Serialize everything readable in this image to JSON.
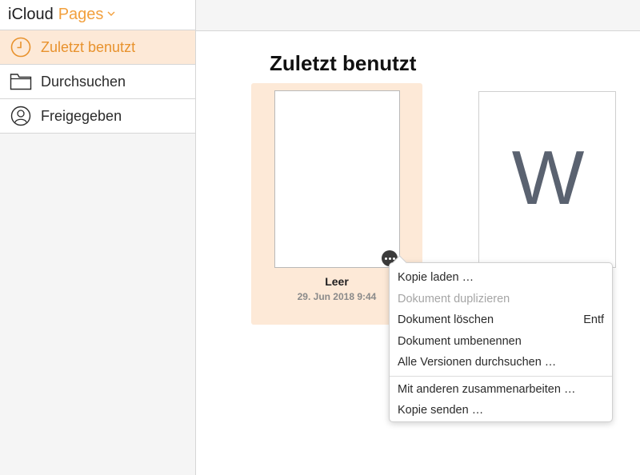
{
  "brand": {
    "app": "iCloud",
    "product": "Pages"
  },
  "sidebar": {
    "items": [
      {
        "label": "Zuletzt benutzt",
        "icon": "clock-icon",
        "active": true
      },
      {
        "label": "Durchsuchen",
        "icon": "folder-icon",
        "active": false
      },
      {
        "label": "Freigegeben",
        "icon": "shared-person-icon",
        "active": false
      }
    ]
  },
  "main": {
    "title": "Zuletzt benutzt",
    "documents": [
      {
        "name": "Leer",
        "date": "29. Jun 2018 9:44",
        "selected": true
      },
      {
        "name": "",
        "date": "",
        "thumb_letter": "W",
        "selected": false
      }
    ]
  },
  "context_menu": {
    "items": [
      {
        "label": "Kopie laden …",
        "shortcut": "",
        "enabled": true
      },
      {
        "label": "Dokument duplizieren",
        "shortcut": "",
        "enabled": false
      },
      {
        "label": "Dokument löschen",
        "shortcut": "Entf",
        "enabled": true
      },
      {
        "label": "Dokument umbenennen",
        "shortcut": "",
        "enabled": true
      },
      {
        "label": "Alle Versionen durchsuchen …",
        "shortcut": "",
        "enabled": true
      },
      {
        "label": "Mit anderen zusammenarbeiten …",
        "shortcut": "",
        "enabled": true
      },
      {
        "label": "Kopie senden …",
        "shortcut": "",
        "enabled": true
      }
    ]
  },
  "colors": {
    "accent": "#f2a03d",
    "selected_bg": "#fde9d7",
    "sidebar_bg": "#f5f5f5"
  }
}
